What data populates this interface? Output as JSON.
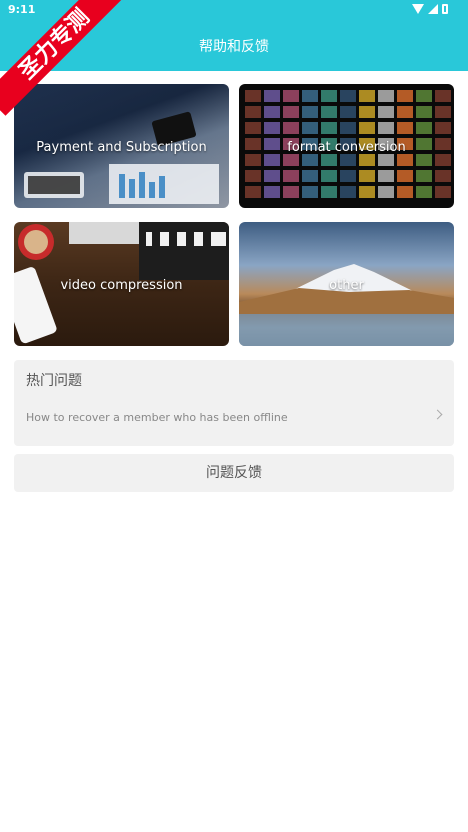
{
  "status_bar": {
    "time": "9:11"
  },
  "header": {
    "title": "帮助和反馈"
  },
  "watermark": {
    "text": "圣力专测"
  },
  "categories": [
    {
      "label": "Payment and Subscription"
    },
    {
      "label": "format conversion"
    },
    {
      "label": "video compression"
    },
    {
      "label": "other"
    }
  ],
  "hot_questions": {
    "title": "热门问题",
    "items": [
      {
        "text": "How to recover a member who has been offline"
      }
    ]
  },
  "feedback_button": {
    "label": "问题反馈"
  },
  "colors": {
    "header_bg": "#29c8d9",
    "panel_bg": "#f1f1f1",
    "watermark_bg": "#e8001e"
  }
}
